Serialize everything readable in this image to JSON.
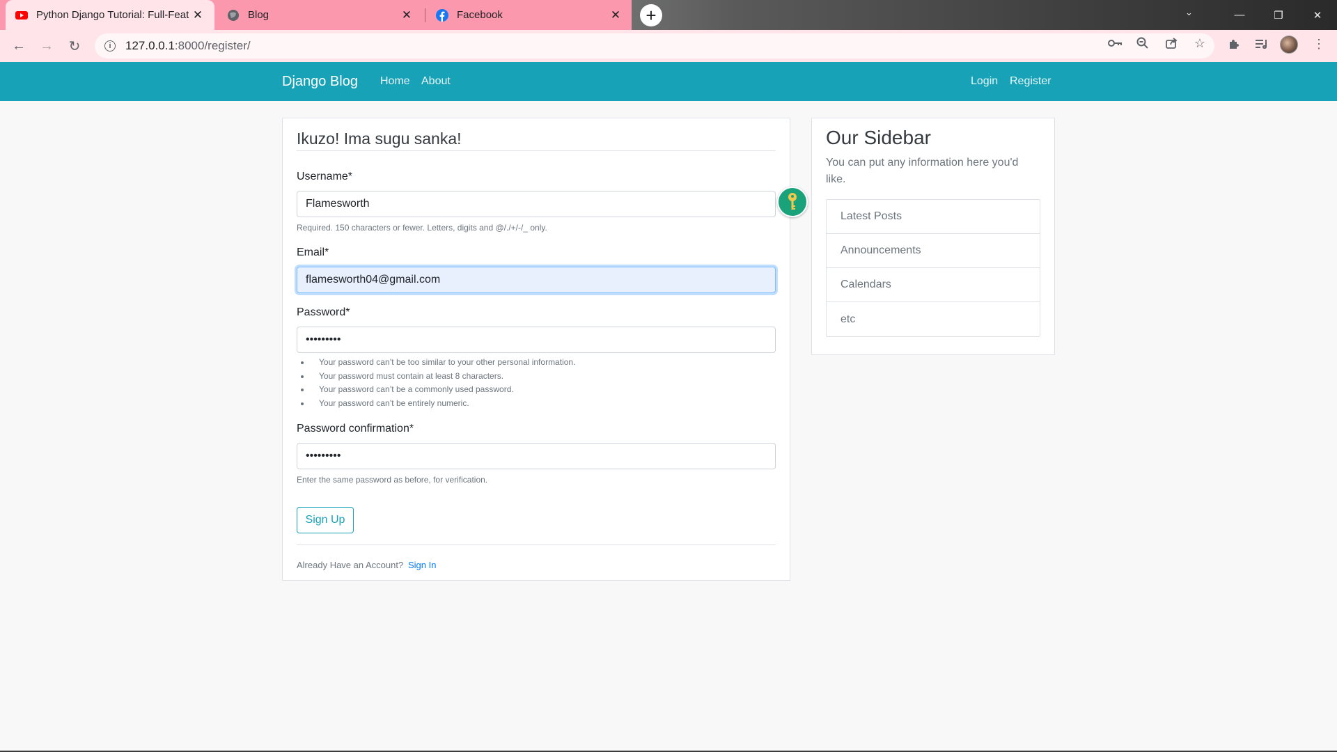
{
  "browser": {
    "tabs": [
      {
        "title": "Python Django Tutorial: Full-Feat",
        "icon": "youtube-icon"
      },
      {
        "title": "Blog",
        "icon": "globe-icon"
      },
      {
        "title": "Facebook",
        "icon": "facebook-icon"
      }
    ],
    "new_tab": "+",
    "address_host": "127.0.0.1",
    "address_path": ":8000/register/"
  },
  "site": {
    "brand": "Django Blog",
    "nav_left": [
      "Home",
      "About"
    ],
    "nav_right": [
      "Login",
      "Register"
    ]
  },
  "form": {
    "legend": "Ikuzo! Ima sugu sanka!",
    "username": {
      "label": "Username*",
      "value": "Flamesworth",
      "help": "Required. 150 characters or fewer. Letters, digits and @/./+/-/_ only."
    },
    "email": {
      "label": "Email*",
      "value": "flamesworth04@gmail.com"
    },
    "password": {
      "label": "Password*",
      "value": "•••••••••",
      "help": [
        "Your password can’t be too similar to your other personal information.",
        "Your password must contain at least 8 characters.",
        "Your password can’t be a commonly used password.",
        "Your password can’t be entirely numeric."
      ]
    },
    "password_confirmation": {
      "label": "Password confirmation*",
      "value": "•••••••••",
      "help": "Enter the same password as before, for verification."
    },
    "submit": "Sign Up",
    "footer_text": "Already Have an Account?",
    "footer_link": "Sign In"
  },
  "sidebar": {
    "title": "Our Sidebar",
    "text": "You can put any information here you'd like.",
    "items": [
      "Latest Posts",
      "Announcements",
      "Calendars",
      "etc"
    ]
  },
  "colors": {
    "navbar": "#17a2b8",
    "tab_strip": "#fb98ad",
    "toolbar": "#ffe4ea",
    "link": "#007bff"
  }
}
